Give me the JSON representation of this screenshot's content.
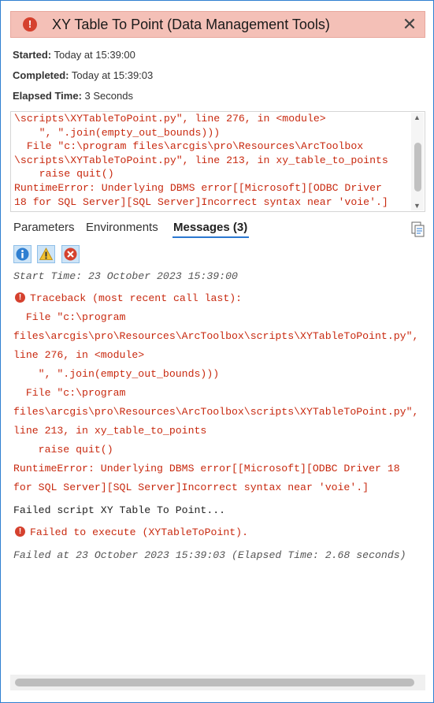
{
  "header": {
    "title": "XY Table To Point (Data Management Tools)",
    "status_icon": "error-icon",
    "close_glyph": "✕",
    "color": "#f4c0b7"
  },
  "info": {
    "started_label": "Started:",
    "started_value": "Today at 15:39:00",
    "completed_label": "Completed:",
    "completed_value": "Today at 15:39:03",
    "elapsed_label": "Elapsed Time:",
    "elapsed_value": "3 Seconds"
  },
  "output_lines": [
    "\\scripts\\XYTableToPoint.py\", line 276, in <module>",
    "    \", \".join(empty_out_bounds)))",
    "  File \"c:\\program files\\arcgis\\pro\\Resources\\ArcToolbox",
    "\\scripts\\XYTableToPoint.py\", line 213, in xy_table_to_points",
    "    raise quit()",
    "RuntimeError: Underlying DBMS error[[Microsoft][ODBC Driver",
    "18 for SQL Server][SQL Server]Incorrect syntax near 'voie'.]"
  ],
  "tabs": [
    {
      "label": "Parameters"
    },
    {
      "label": "Environments"
    },
    {
      "label": "Messages (3)"
    }
  ],
  "filters": {
    "info": "info-filter-icon",
    "warning": "warning-filter-icon",
    "error": "error-filter-icon"
  },
  "messages": {
    "start_time": "Start Time: 23 October 2023 15:39:00",
    "traceback": [
      "Traceback (most recent call last):",
      "  File \"c:\\program",
      "files\\arcgis\\pro\\Resources\\ArcToolbox\\scripts\\XYTableToPoint.py\",",
      "line 276, in <module>",
      "    \", \".join(empty_out_bounds)))",
      "  File \"c:\\program",
      "files\\arcgis\\pro\\Resources\\ArcToolbox\\scripts\\XYTableToPoint.py\",",
      "line 213, in xy_table_to_points",
      "    raise quit()",
      "RuntimeError: Underlying DBMS error[[Microsoft][ODBC Driver 18",
      "for SQL Server][SQL Server]Incorrect syntax near 'voie'.]"
    ],
    "failed_script": "Failed script XY Table To Point...",
    "failed_execute": "Failed to execute (XYTableToPoint).",
    "failed_at": "Failed at 23 October 2023 15:39:03 (Elapsed Time: 2.68 seconds)"
  },
  "colors": {
    "error_text": "#c8290f",
    "accent": "#2b78d0",
    "error_badge": "#d5412e"
  }
}
